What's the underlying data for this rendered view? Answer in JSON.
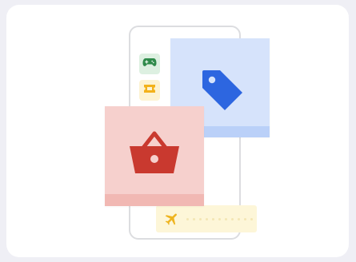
{
  "illustration": {
    "icons": {
      "games": "gamepad-icon",
      "tickets": "ticket-icon",
      "deals": "price-tag-icon",
      "shopping": "shopping-basket-icon",
      "travel": "airplane-icon"
    },
    "colors": {
      "page_background": "#efeff5",
      "card_background": "#ffffff",
      "phone_border": "#dcdde0",
      "games_chip_bg": "#ddf0e1",
      "games_icon": "#2e8a4a",
      "tickets_chip_bg": "#fdf3d2",
      "tickets_icon": "#f3b21b",
      "tag_tile_bg": "#d6e3fb",
      "tag_tile_band": "#bad0f8",
      "tag_icon": "#2d66e0",
      "basket_tile_bg": "#f6d0cd",
      "basket_tile_band": "#f1b8b3",
      "basket_icon": "#c9392f",
      "travel_strip_bg": "#fdf6d8",
      "travel_icon": "#eeb420"
    }
  }
}
